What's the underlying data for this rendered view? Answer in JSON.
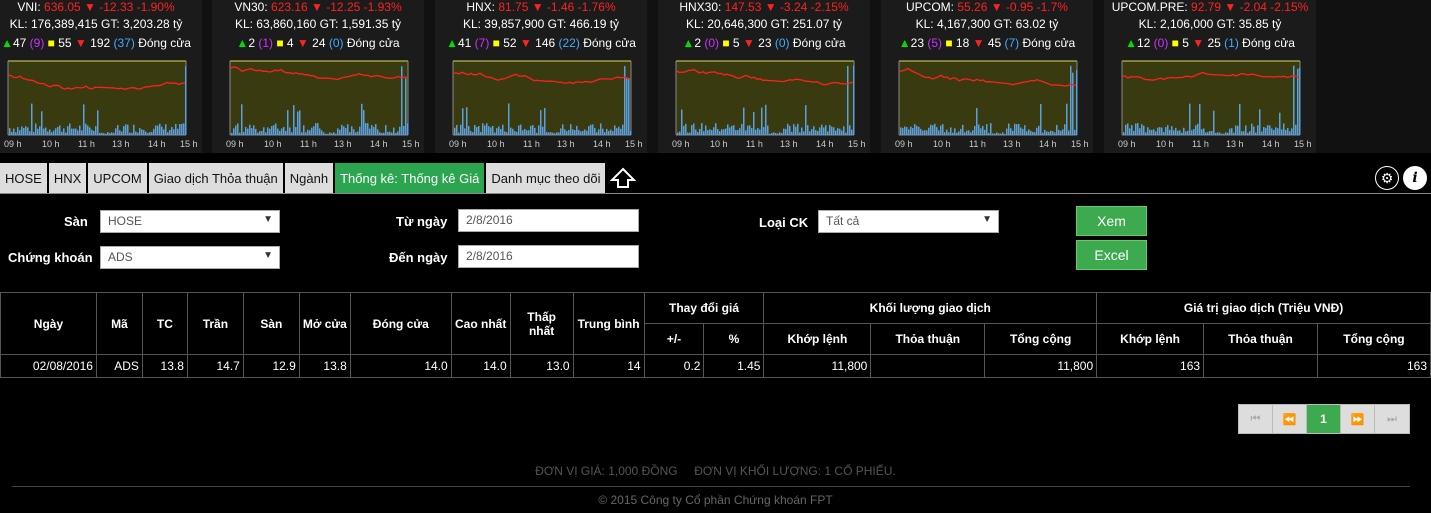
{
  "indices": [
    {
      "name": "VNI",
      "value": "636.05",
      "change": "-12.33",
      "pct": "-1.90%",
      "volume": "KL: 176,389,415 GT: 3,203.28 tỷ",
      "up": "47",
      "ceil": "(9)",
      "flat": "55",
      "down": "192",
      "floor": "(37)",
      "status": "Đóng cửa"
    },
    {
      "name": "VN30",
      "value": "623.16",
      "change": "-12.25",
      "pct": "-1.93%",
      "volume": "KL: 63,860,160 GT: 1,591.35 tỷ",
      "up": "2",
      "ceil": "(1)",
      "flat": "4",
      "down": "24",
      "floor": "(0)",
      "status": "Đóng cửa"
    },
    {
      "name": "HNX",
      "value": "81.75",
      "change": "-1.46",
      "pct": "-1.76%",
      "volume": "KL: 39,857,900 GT: 466.19 tỷ",
      "up": "41",
      "ceil": "(7)",
      "flat": "52",
      "down": "146",
      "floor": "(22)",
      "status": "Đóng cửa"
    },
    {
      "name": "HNX30",
      "value": "147.53",
      "change": "-3.24",
      "pct": "-2.15%",
      "volume": "KL: 20,646,300 GT: 251.07 tỷ",
      "up": "2",
      "ceil": "(0)",
      "flat": "5",
      "down": "23",
      "floor": "(0)",
      "status": "Đóng cửa"
    },
    {
      "name": "UPCOM",
      "value": "55.26",
      "change": "-0.95",
      "pct": "-1.7%",
      "volume": "KL: 4,167,300 GT: 63.02 tỷ",
      "up": "23",
      "ceil": "(5)",
      "flat": "18",
      "down": "45",
      "floor": "(7)",
      "status": "Đóng cửa"
    },
    {
      "name": "UPCOM.PRE",
      "value": "92.79",
      "change": "-2.04",
      "pct": "-2.15%",
      "volume": "KL: 2,106,000 GT: 35.85 tỷ",
      "up": "12",
      "ceil": "(0)",
      "flat": "5",
      "down": "25",
      "floor": "(1)",
      "status": "Đóng cửa"
    }
  ],
  "chart_hours": [
    "09 h",
    "10 h",
    "11 h",
    "13 h",
    "14 h",
    "15 h"
  ],
  "chart_colors": {
    "price": "#ff2020",
    "volume": "#5aa0e0",
    "area": "#3a3a10",
    "axis": "#d8d860"
  },
  "tabs": [
    "HOSE",
    "HNX",
    "UPCOM",
    "Giao dịch Thỏa thuận",
    "Ngành",
    "Thống kê: Thống kê Giá",
    "Danh mục theo dõi"
  ],
  "active_tab": 5,
  "icons": {
    "collapse": "up-arrow-icon",
    "settings": "gear-icon",
    "info": "info-icon"
  },
  "form": {
    "san_label": "Sàn",
    "san_value": "HOSE",
    "ck_label": "Chứng khoán",
    "ck_value": "ADS",
    "from_label": "Từ ngày",
    "from_value": "2/8/2016",
    "to_label": "Đến ngày",
    "to_value": "2/8/2016",
    "type_label": "Loại CK",
    "type_value": "Tất cả",
    "view_button": "Xem",
    "excel_button": "Excel"
  },
  "table": {
    "headers": {
      "date": "Ngày",
      "code": "Mã",
      "ref": "TC",
      "ceil": "Trần",
      "floor": "Sàn",
      "open": "Mở cửa",
      "close": "Đóng cửa",
      "high": "Cao nhất",
      "low": "Thấp nhất",
      "avg": "Trung bình",
      "change_group": "Thay đổi giá",
      "change_abs": "+/-",
      "change_pct": "%",
      "vol_group": "Khối lượng giao dịch",
      "vol_match": "Khớp lệnh",
      "vol_deal": "Thỏa thuận",
      "vol_total": "Tổng cộng",
      "val_group": "Giá trị giao dịch (Triệu VNĐ)",
      "val_match": "Khớp lệnh",
      "val_deal": "Thỏa thuận",
      "val_total": "Tổng cộng"
    },
    "rows": [
      {
        "date": "02/08/2016",
        "code": "ADS",
        "ref": "13.8",
        "ceil": "14.7",
        "floor": "12.9",
        "open": "13.8",
        "close": "14.0",
        "high": "14.0",
        "low": "13.0",
        "avg": "14",
        "change_abs": "0.2",
        "change_pct": "1.45",
        "vol_match": "11,800",
        "vol_deal": "",
        "vol_total": "11,800",
        "val_match": "163",
        "val_deal": "",
        "val_total": "163"
      }
    ]
  },
  "pager": {
    "current": "1"
  },
  "footer_note": "ĐƠN VỊ GIÁ: 1,000 ĐỒNG     ĐƠN VỊ KHỐI LƯỢNG: 1 CỔ PHIẾU.",
  "copyright": "© 2015 Công ty Cổ phần Chứng khoán FPT"
}
